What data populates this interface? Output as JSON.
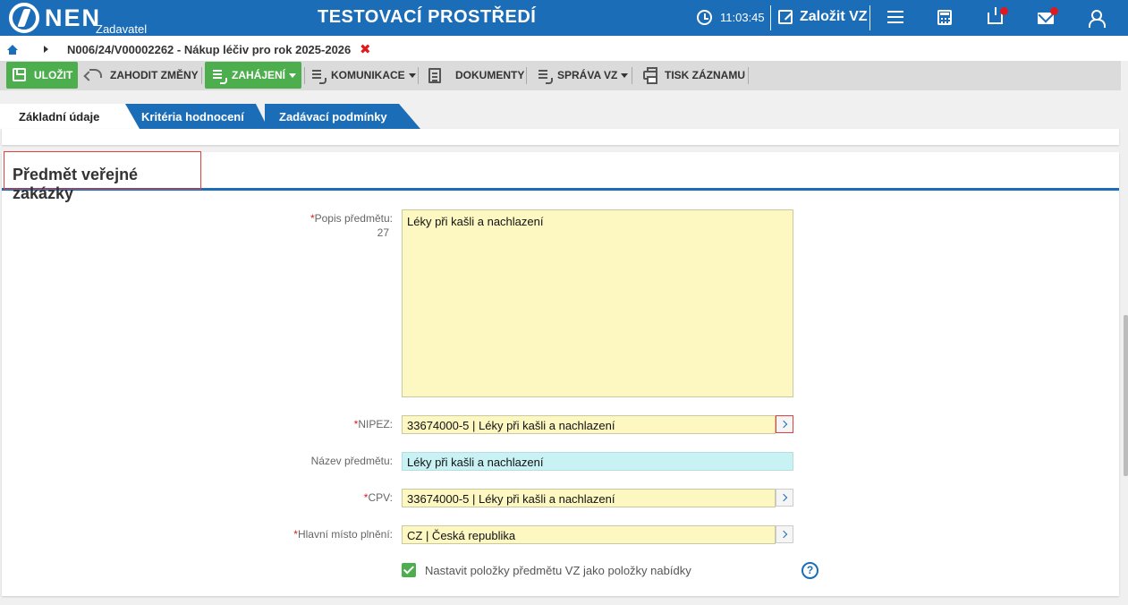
{
  "header": {
    "brand": "NEN",
    "brand_sub": "Zadavatel",
    "env_title": "TESTOVACÍ PROSTŘEDÍ",
    "time": "11:03:45",
    "create_label": "Založit VZ"
  },
  "breadcrumb": {
    "record": "N006/24/V00002262 - Nákup léčiv pro rok 2025-2026",
    "close": "✖"
  },
  "toolbar": {
    "save": "ULOŽIT",
    "discard": "ZAHODIT ZMĚNY",
    "start": "ZAHÁJENÍ",
    "communication": "KOMUNIKACE",
    "documents": "DOKUMENTY",
    "management": "SPRÁVA VZ",
    "print": "TISK ZÁZNAMU"
  },
  "tabs": [
    {
      "label": "Základní údaje",
      "active": true
    },
    {
      "label": "Kritéria hodnocení",
      "active": false
    },
    {
      "label": "Zadávací podmínky",
      "active": false
    }
  ],
  "section": {
    "title": "Předmět veřejné zakázky",
    "fields": {
      "description": {
        "label": "Popis předmětu:",
        "counter": "27",
        "value": "Léky při kašli a nachlazení",
        "required": "*"
      },
      "nipez": {
        "label": "NIPEZ:",
        "value": "33674000-5 | Léky při kašli a nachlazení",
        "required": "*"
      },
      "name": {
        "label": "Název předmětu:",
        "value": "Léky při kašli a nachlazení"
      },
      "cpv": {
        "label": "CPV:",
        "value": "33674000-5 | Léky při kašli a nachlazení",
        "required": "*"
      },
      "place": {
        "label": "Hlavní místo plnění:",
        "value": "CZ | Česká republika",
        "required": "*"
      }
    },
    "checkbox_label": "Nastavit položky předmětu VZ jako položky nabídky",
    "help": "?"
  },
  "colors": {
    "brand_blue": "#1c6db7",
    "green": "#4cae4c",
    "field_yellow": "#fdf7c2",
    "field_cyan": "#c9f2f5",
    "alert_red": "#e0191e"
  }
}
